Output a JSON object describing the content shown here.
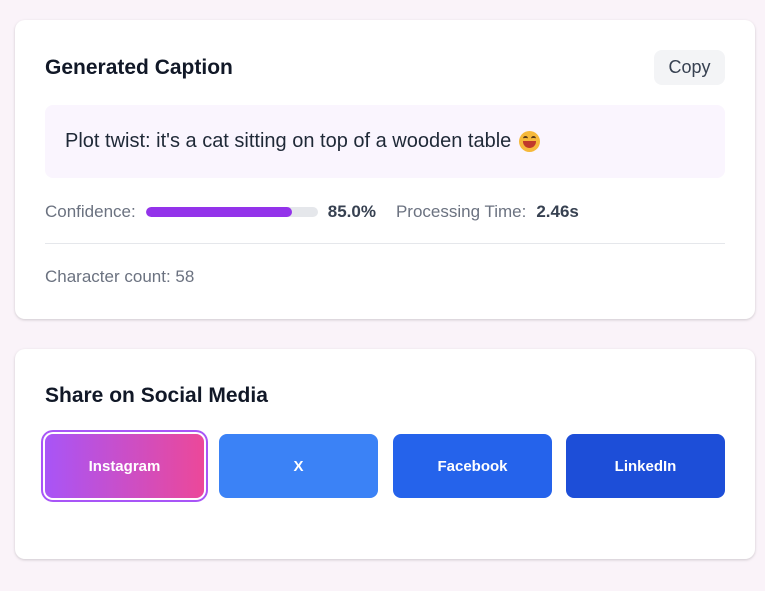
{
  "caption_card": {
    "title": "Generated Caption",
    "copy_label": "Copy",
    "caption_text": "Plot twist: it's a cat sitting on top of a wooden table",
    "caption_emoji": "grinning-face-emoji",
    "confidence_label": "Confidence:",
    "confidence_fraction": 0.85,
    "confidence_value": "85.0%",
    "processing_label": "Processing Time:",
    "processing_value": "2.46s",
    "char_count_text": "Character count: 58"
  },
  "share_card": {
    "title": "Share on Social Media",
    "buttons": [
      {
        "label": "Instagram",
        "color": "#a855f7 → #ec4899"
      },
      {
        "label": "X",
        "color": "#3b82f6"
      },
      {
        "label": "Facebook",
        "color": "#2563eb"
      },
      {
        "label": "LinkedIn",
        "color": "#1d4ed8"
      }
    ]
  },
  "colors": {
    "accent": "#9333ea",
    "page_background": "#faf3f9"
  }
}
